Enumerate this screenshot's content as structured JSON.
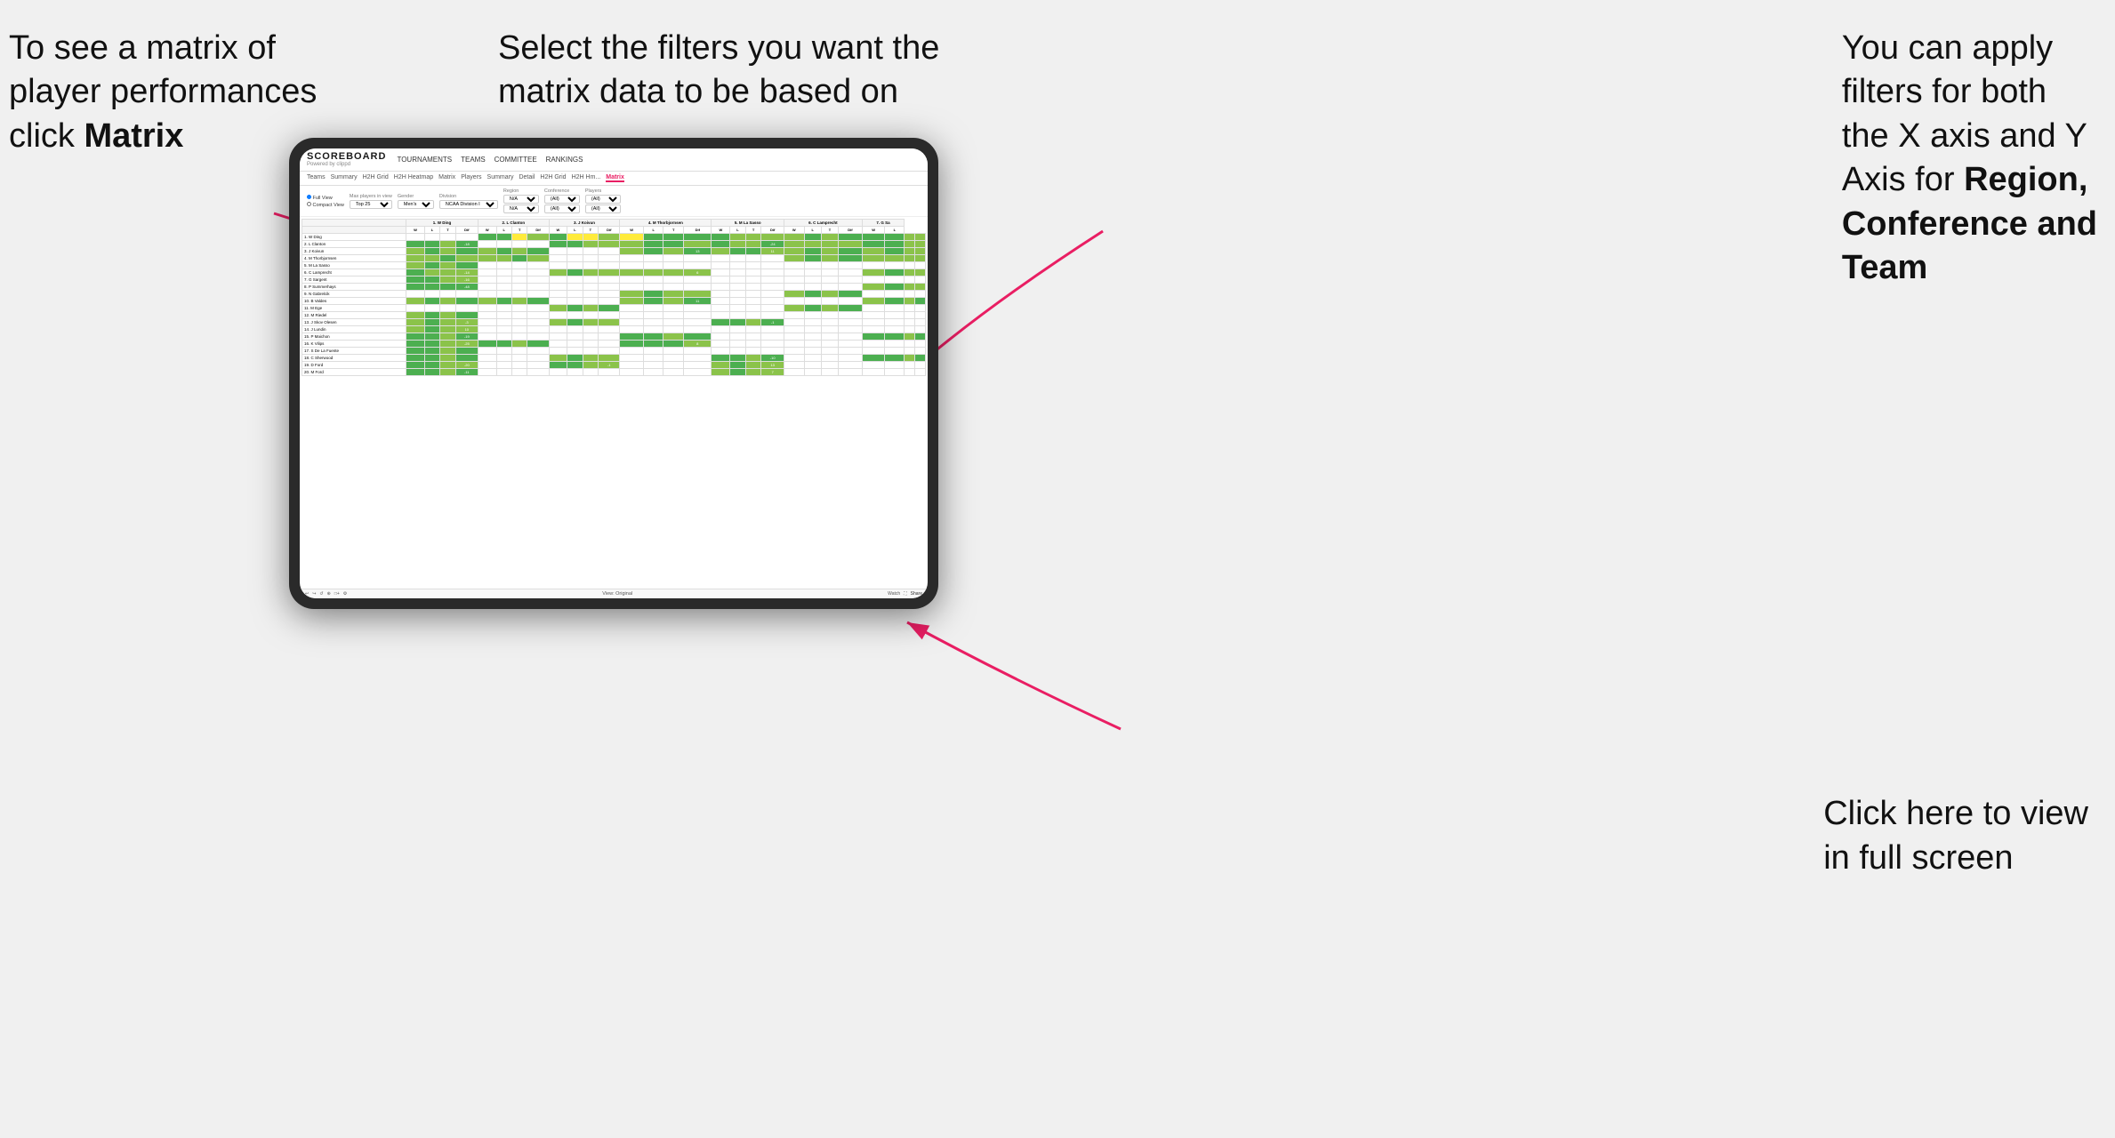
{
  "annotations": {
    "top_left": {
      "line1": "To see a matrix of",
      "line2": "player performances",
      "line3_prefix": "click ",
      "line3_bold": "Matrix"
    },
    "top_center": {
      "line1": "Select the filters you want the",
      "line2": "matrix data to be based on"
    },
    "top_right": {
      "line1": "You  can apply",
      "line2": "filters for both",
      "line3": "the X axis and Y",
      "line4_prefix": "Axis for ",
      "line4_bold": "Region,",
      "line5_bold": "Conference and",
      "line6_bold": "Team"
    },
    "bottom_right": {
      "line1": "Click here to view",
      "line2": "in full screen"
    }
  },
  "scoreboard": {
    "logo_title": "SCOREBOARD",
    "logo_sub": "Powered by clippd",
    "nav_items": [
      "TOURNAMENTS",
      "TEAMS",
      "COMMITTEE",
      "RANKINGS"
    ],
    "tabs": [
      "Teams",
      "Summary",
      "H2H Grid",
      "H2H Heatmap",
      "Matrix",
      "Players",
      "Summary",
      "Detail",
      "H2H Grid",
      "H2H Hm...",
      "Matrix"
    ],
    "active_tab": "Matrix",
    "filters": {
      "view_options": [
        "Full View",
        "Compact View"
      ],
      "max_players_label": "Max players in view",
      "max_players_value": "Top 25",
      "gender_label": "Gender",
      "gender_value": "Men's",
      "division_label": "Division",
      "division_value": "NCAA Division I",
      "region_label": "Region",
      "region_value": "N/A",
      "conference_label": "Conference",
      "conference_value": "(All)",
      "players_label": "Players",
      "players_value": "(All)"
    },
    "col_headers": [
      "1. W Ding",
      "2. L Clanton",
      "3. J Koivun",
      "4. M Thorbjornsen",
      "5. M La Sasso",
      "6. C Lamprecht",
      "7. G Sa"
    ],
    "sub_headers": [
      "W",
      "L",
      "T",
      "Dif"
    ],
    "rows": [
      {
        "name": "1. W Ding",
        "cells": [
          [
            null,
            null,
            null,
            null
          ],
          [
            "g",
            "g",
            "y",
            "n"
          ],
          [
            "g",
            "y",
            "y",
            "n"
          ],
          [
            "y",
            "g",
            "g",
            "g"
          ],
          [
            "g",
            "n",
            "n",
            "n"
          ],
          [
            "n",
            "g",
            "n",
            "g"
          ],
          [
            "g",
            "g",
            "n",
            "n"
          ]
        ]
      },
      {
        "name": "2. L Clanton",
        "cells": [
          [
            "g",
            "g",
            "n",
            "-18"
          ],
          [
            null,
            null,
            null,
            null
          ],
          [
            "g",
            "g",
            "n",
            "n"
          ],
          [
            "n",
            "g",
            "g",
            "n"
          ],
          [
            "g",
            "n",
            "n",
            "-24"
          ],
          [
            "n",
            "n",
            "n",
            "n"
          ],
          [
            "g",
            "g",
            "n",
            "n"
          ]
        ]
      },
      {
        "name": "3. J Koivun",
        "cells": [
          [
            "n",
            "g",
            "n",
            "g"
          ],
          [
            "n",
            "g",
            "n",
            "g"
          ],
          [
            null,
            null,
            null,
            null
          ],
          [
            "n",
            "g",
            "n",
            "13"
          ],
          [
            "n",
            "g",
            "g",
            "11"
          ],
          [
            "n",
            "g",
            "n",
            "g"
          ],
          [
            "n",
            "g",
            "n",
            "n"
          ]
        ]
      },
      {
        "name": "4. M Thorbjornsen",
        "cells": [
          [
            "n",
            "n",
            "g",
            "n"
          ],
          [
            "n",
            "n",
            "g",
            "n"
          ],
          [
            null,
            null,
            null,
            null
          ],
          [
            null,
            null,
            null,
            null
          ],
          [
            null,
            null,
            null,
            null
          ],
          [
            "n",
            "g",
            "n",
            "g"
          ],
          [
            "n",
            "n",
            "n",
            "n"
          ]
        ]
      },
      {
        "name": "5. M La Sasso",
        "cells": [
          [
            "n",
            "g",
            "n",
            "g"
          ],
          [
            null,
            null,
            null,
            null
          ],
          [
            null,
            null,
            null,
            null
          ],
          [
            null,
            null,
            null,
            null
          ],
          [
            null,
            null,
            null,
            null
          ],
          [
            null,
            null,
            null,
            null
          ],
          [
            null,
            null,
            null,
            null
          ]
        ]
      },
      {
        "name": "6. C Lamprecht",
        "cells": [
          [
            "g",
            "n",
            "n",
            "-14"
          ],
          [
            null,
            null,
            null,
            null
          ],
          [
            "n",
            "g",
            "n",
            "n"
          ],
          [
            "n",
            "n",
            "n",
            "6"
          ],
          [
            null,
            null,
            null,
            null
          ],
          [
            null,
            null,
            null,
            null
          ],
          [
            "n",
            "g",
            "n",
            "n"
          ]
        ]
      },
      {
        "name": "7. G Sargent",
        "cells": [
          [
            "g",
            "g",
            "n",
            "-16"
          ],
          [
            null,
            null,
            null,
            null
          ],
          [
            null,
            null,
            null,
            null
          ],
          [
            null,
            null,
            null,
            null
          ],
          [
            null,
            null,
            null,
            null
          ],
          [
            null,
            null,
            null,
            null
          ],
          [
            null,
            null,
            null,
            null
          ]
        ]
      },
      {
        "name": "8. P Summerhays",
        "cells": [
          [
            "g",
            "g",
            "g",
            "-48"
          ],
          [
            null,
            null,
            null,
            null
          ],
          [
            null,
            null,
            null,
            null
          ],
          [
            null,
            null,
            null,
            null
          ],
          [
            null,
            null,
            null,
            null
          ],
          [
            null,
            null,
            null,
            null
          ],
          [
            "n",
            "g",
            "n",
            "n"
          ]
        ]
      },
      {
        "name": "9. N Gabrelcik",
        "cells": [
          [
            null,
            null,
            null,
            null
          ],
          [
            null,
            null,
            null,
            null
          ],
          [
            null,
            null,
            null,
            null
          ],
          [
            "n",
            "g",
            "n",
            "n"
          ],
          [
            null,
            null,
            null,
            null
          ],
          [
            "n",
            "g",
            "n",
            "g"
          ],
          [
            null,
            null,
            null,
            null
          ]
        ]
      },
      {
        "name": "10. B Valdes",
        "cells": [
          [
            "n",
            "g",
            "n",
            "g"
          ],
          [
            "n",
            "g",
            "n",
            "g"
          ],
          [
            null,
            null,
            null,
            null
          ],
          [
            "n",
            "g",
            "n",
            "11"
          ],
          [
            null,
            null,
            null,
            null
          ],
          [
            null,
            null,
            null,
            null
          ],
          [
            "n",
            "g",
            "n",
            "g"
          ]
        ]
      },
      {
        "name": "11. M Ege",
        "cells": [
          [
            null,
            null,
            null,
            null
          ],
          [
            null,
            null,
            null,
            null
          ],
          [
            "n",
            "g",
            "n",
            "g"
          ],
          [
            null,
            null,
            null,
            null
          ],
          [
            null,
            null,
            null,
            null
          ],
          [
            "n",
            "g",
            "n",
            "g"
          ],
          [
            null,
            null,
            null,
            null
          ]
        ]
      },
      {
        "name": "12. M Riedel",
        "cells": [
          [
            "n",
            "g",
            "n",
            "g"
          ],
          [
            null,
            null,
            null,
            null
          ],
          [
            null,
            null,
            null,
            null
          ],
          [
            null,
            null,
            null,
            null
          ],
          [
            null,
            null,
            null,
            null
          ],
          [
            null,
            null,
            null,
            null
          ],
          [
            null,
            null,
            null,
            null
          ]
        ]
      },
      {
        "name": "13. J Skov Olesen",
        "cells": [
          [
            "n",
            "g",
            "n",
            "-3"
          ],
          [
            null,
            null,
            null,
            null
          ],
          [
            "n",
            "g",
            "n",
            "n"
          ],
          [
            null,
            null,
            null,
            null
          ],
          [
            "g",
            "g",
            "n",
            "-1"
          ],
          [
            null,
            null,
            null,
            null
          ],
          [
            null,
            null,
            null,
            null
          ]
        ]
      },
      {
        "name": "14. J Lundin",
        "cells": [
          [
            "n",
            "g",
            "n",
            "10"
          ],
          [
            null,
            null,
            null,
            null
          ],
          [
            null,
            null,
            null,
            null
          ],
          [
            null,
            null,
            null,
            null
          ],
          [
            null,
            null,
            null,
            null
          ],
          [
            null,
            null,
            null,
            null
          ],
          [
            null,
            null,
            null,
            null
          ]
        ]
      },
      {
        "name": "15. P Maichon",
        "cells": [
          [
            "g",
            "g",
            "n",
            "-19"
          ],
          [
            null,
            null,
            null,
            null
          ],
          [
            null,
            null,
            null,
            null
          ],
          [
            "g",
            "g",
            "n",
            "g"
          ],
          [
            null,
            null,
            null,
            null
          ],
          [
            null,
            null,
            null,
            null
          ],
          [
            "g",
            "g",
            "n",
            "g"
          ]
        ]
      },
      {
        "name": "16. K Vilips",
        "cells": [
          [
            "g",
            "g",
            "n",
            "-25"
          ],
          [
            "g",
            "g",
            "n",
            "g"
          ],
          [
            null,
            null,
            null,
            null
          ],
          [
            "g",
            "g",
            "g",
            "8"
          ],
          [
            null,
            null,
            null,
            null
          ],
          [
            null,
            null,
            null,
            null
          ],
          [
            null,
            null,
            null,
            null
          ]
        ]
      },
      {
        "name": "17. S De La Fuente",
        "cells": [
          [
            "g",
            "g",
            "n",
            "g"
          ],
          [
            null,
            null,
            null,
            null
          ],
          [
            null,
            null,
            null,
            null
          ],
          [
            null,
            null,
            null,
            null
          ],
          [
            null,
            null,
            null,
            null
          ],
          [
            null,
            null,
            null,
            null
          ],
          [
            null,
            null,
            null,
            null
          ]
        ]
      },
      {
        "name": "18. C Sherwood",
        "cells": [
          [
            "g",
            "g",
            "n",
            "g"
          ],
          [
            null,
            null,
            null,
            null
          ],
          [
            "n",
            "g",
            "n",
            "n"
          ],
          [
            null,
            null,
            null,
            null
          ],
          [
            "g",
            "g",
            "n",
            "-10"
          ],
          [
            null,
            null,
            null,
            null
          ],
          [
            "g",
            "g",
            "n",
            "g"
          ]
        ]
      },
      {
        "name": "19. D Ford",
        "cells": [
          [
            "g",
            "g",
            "n",
            "-20"
          ],
          [
            null,
            null,
            null,
            null
          ],
          [
            "g",
            "g",
            "n",
            "-1"
          ],
          [
            null,
            null,
            null,
            null
          ],
          [
            "n",
            "g",
            "n",
            "13"
          ],
          [
            null,
            null,
            null,
            null
          ],
          [
            null,
            null,
            null,
            null
          ]
        ]
      },
      {
        "name": "20. M Ford",
        "cells": [
          [
            "g",
            "g",
            "n",
            "-11"
          ],
          [
            null,
            null,
            null,
            null
          ],
          [
            null,
            null,
            null,
            null
          ],
          [
            null,
            null,
            null,
            null
          ],
          [
            "n",
            "g",
            "n",
            "7"
          ],
          [
            null,
            null,
            null,
            null
          ],
          [
            null,
            null,
            null,
            null
          ]
        ]
      }
    ],
    "toolbar": {
      "view_original": "View: Original",
      "watch": "Watch",
      "share": "Share"
    }
  }
}
